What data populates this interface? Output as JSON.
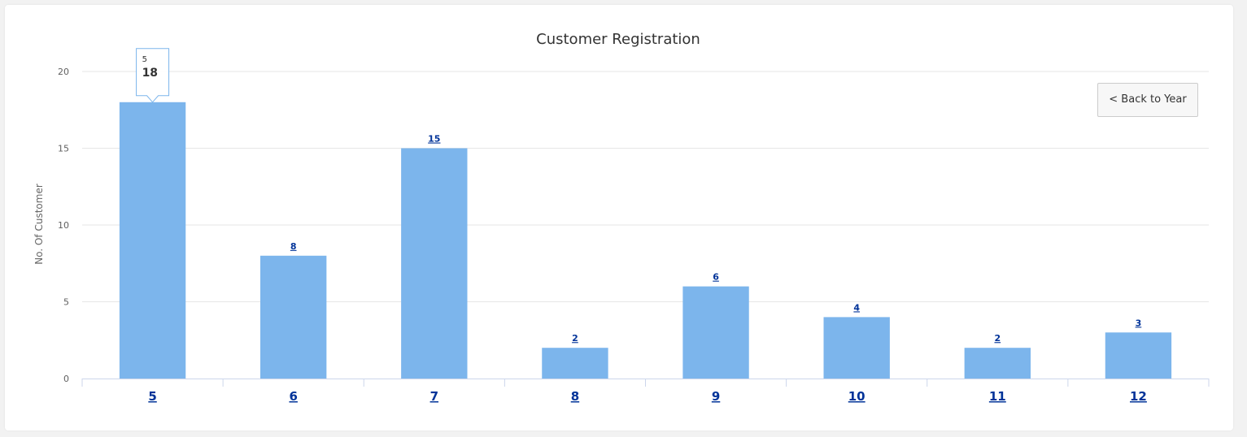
{
  "page": {
    "back_button_label": "< Back to Year"
  },
  "chart_data": {
    "type": "bar",
    "title": "Customer Registration",
    "xlabel": "",
    "ylabel": "No. Of Customer",
    "categories": [
      "5",
      "6",
      "7",
      "8",
      "9",
      "10",
      "11",
      "12"
    ],
    "values": [
      18,
      8,
      15,
      2,
      6,
      4,
      2,
      3
    ],
    "ylim": [
      0,
      20
    ],
    "yticks": [
      0,
      5,
      10,
      15,
      20
    ],
    "grid": true,
    "legend": "none",
    "bar_color": "#7cb5ec",
    "tooltip": {
      "category": "5",
      "value": "18"
    }
  }
}
